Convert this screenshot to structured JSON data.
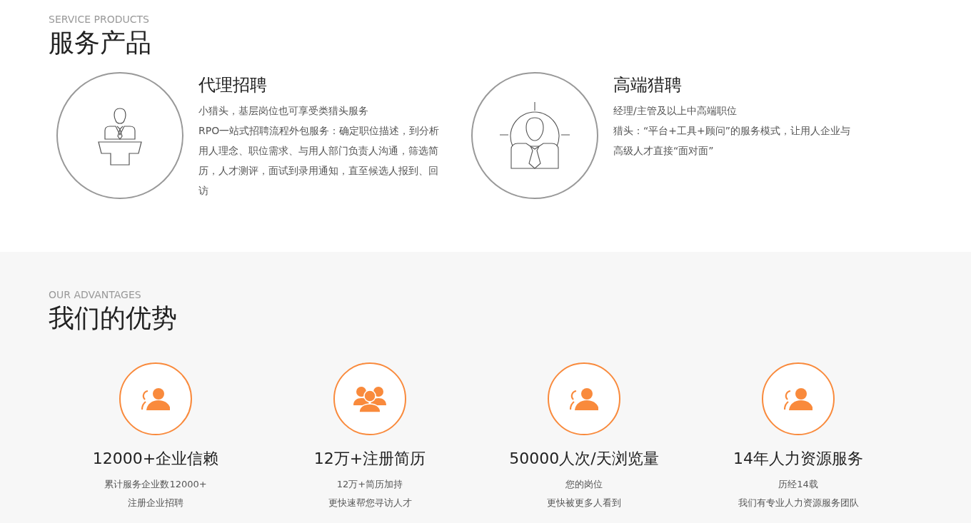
{
  "services": {
    "eyebrow": "SERVICE PRODUCTS",
    "title": "服务产品",
    "items": [
      {
        "kind": "podium",
        "title": "代理招聘",
        "paragraphs": [
          "小猎头，基层岗位也可享受类猎头服务",
          "RPO一站式招聘流程外包服务：确定职位描述，到分析用人理念、职位需求、与用人部门负责人沟通，筛选简历，人才测评，面试到录用通知，直至候选人报到、回访"
        ]
      },
      {
        "kind": "target",
        "title": "高端猎聘",
        "paragraphs": [
          "经理/主管及以上中高端职位",
          "猎头：“平台+工具+顾问”的服务模式，让用人企业与高级人才直接“面对面”"
        ]
      }
    ]
  },
  "advantages": {
    "eyebrow": "OUR ADVANTAGES",
    "title": "我们的优势",
    "items": [
      {
        "kind": "person",
        "headline": "12000+企业信赖",
        "lines": [
          "累计服务企业数12000+",
          "注册企业招聘"
        ]
      },
      {
        "kind": "group",
        "headline": "12万+注册简历",
        "lines": [
          "12万+简历加持",
          "更快速帮您寻访人才"
        ]
      },
      {
        "kind": "person",
        "headline": "50000人次/天浏览量",
        "lines": [
          "您的岗位",
          "更快被更多人看到"
        ]
      },
      {
        "kind": "person",
        "headline": "14年人力资源服务",
        "lines": [
          "历经14载",
          "我们有专业人力资源服务团队"
        ]
      }
    ]
  }
}
